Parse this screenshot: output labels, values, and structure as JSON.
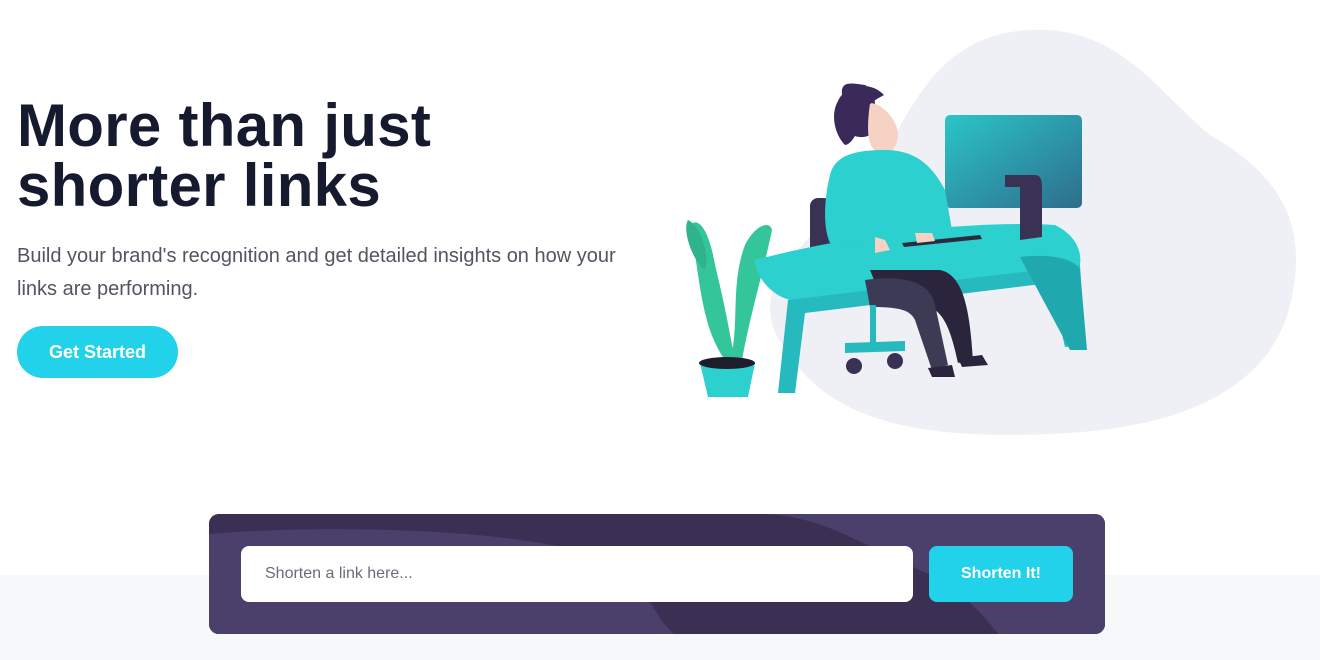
{
  "hero": {
    "title_line1": "More than just",
    "title_line2": "shorter links",
    "description": "Build your brand's recognition and get detailed insights on how your links are performing.",
    "cta_label": "Get Started"
  },
  "shortener": {
    "placeholder": "Shorten a link here...",
    "button_label": "Shorten It!"
  },
  "colors": {
    "primary": "#21d2ea",
    "dark_violet": "#3b3054",
    "heading": "#161a2e",
    "body_text": "#55535f"
  },
  "illustration": {
    "name": "person-working-at-desk-illustration"
  }
}
